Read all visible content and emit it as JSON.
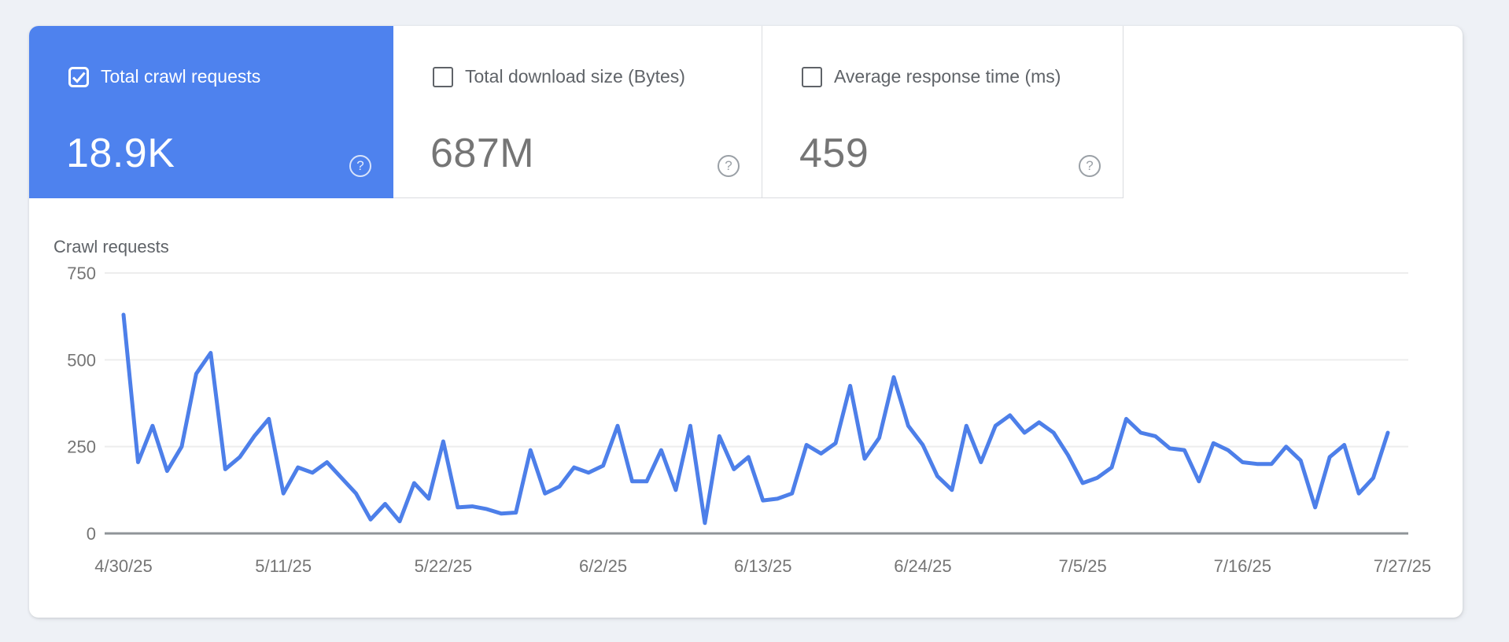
{
  "cards": [
    {
      "label": "Total crawl requests",
      "value": "18.9K",
      "selected": true,
      "checkbox": "checked"
    },
    {
      "label": "Total download size (Bytes)",
      "value": "687M",
      "selected": false,
      "checkbox": "unchecked"
    },
    {
      "label": "Average response time (ms)",
      "value": "459",
      "selected": false,
      "checkbox": "unchecked"
    }
  ],
  "icons": {
    "help_glyph": "?",
    "checkmark": "check-icon"
  },
  "colors": {
    "selected_card_bg": "#4e82ee",
    "line": "#4d7fe9",
    "grid": "#ededed",
    "axis_line": "#8f9498",
    "axis_text": "#757575",
    "divider": "#dadce0",
    "page_bg": "#eef1f6"
  },
  "chart_data": {
    "type": "line",
    "title": "Crawl requests",
    "series": [
      {
        "name": "Total crawl requests",
        "values": [
          630,
          205,
          310,
          180,
          250,
          460,
          520,
          185,
          220,
          280,
          330,
          115,
          190,
          175,
          205,
          160,
          115,
          40,
          85,
          35,
          145,
          100,
          265,
          75,
          78,
          70,
          57,
          60,
          240,
          115,
          135,
          190,
          175,
          195,
          310,
          150,
          150,
          240,
          125,
          310,
          30,
          280,
          185,
          220,
          95,
          100,
          115,
          255,
          230,
          260,
          425,
          215,
          275,
          450,
          310,
          255,
          165,
          125,
          310,
          205,
          310,
          340,
          290,
          320,
          290,
          225,
          145,
          160,
          190,
          330,
          290,
          280,
          245,
          240,
          150,
          260,
          240,
          205,
          200,
          200,
          250,
          210,
          75,
          220,
          255,
          115,
          160,
          290
        ]
      }
    ],
    "x_first_date": "4/30/25",
    "x_tick_labels": [
      "4/30/25",
      "5/11/25",
      "5/22/25",
      "6/2/25",
      "6/13/25",
      "6/24/25",
      "7/5/25",
      "7/16/25",
      "7/27/25"
    ],
    "x_tick_interval_days": 11,
    "y_ticks": [
      0,
      250,
      500,
      750
    ],
    "ylim": [
      0,
      750
    ],
    "grid": true,
    "legend": "none"
  }
}
